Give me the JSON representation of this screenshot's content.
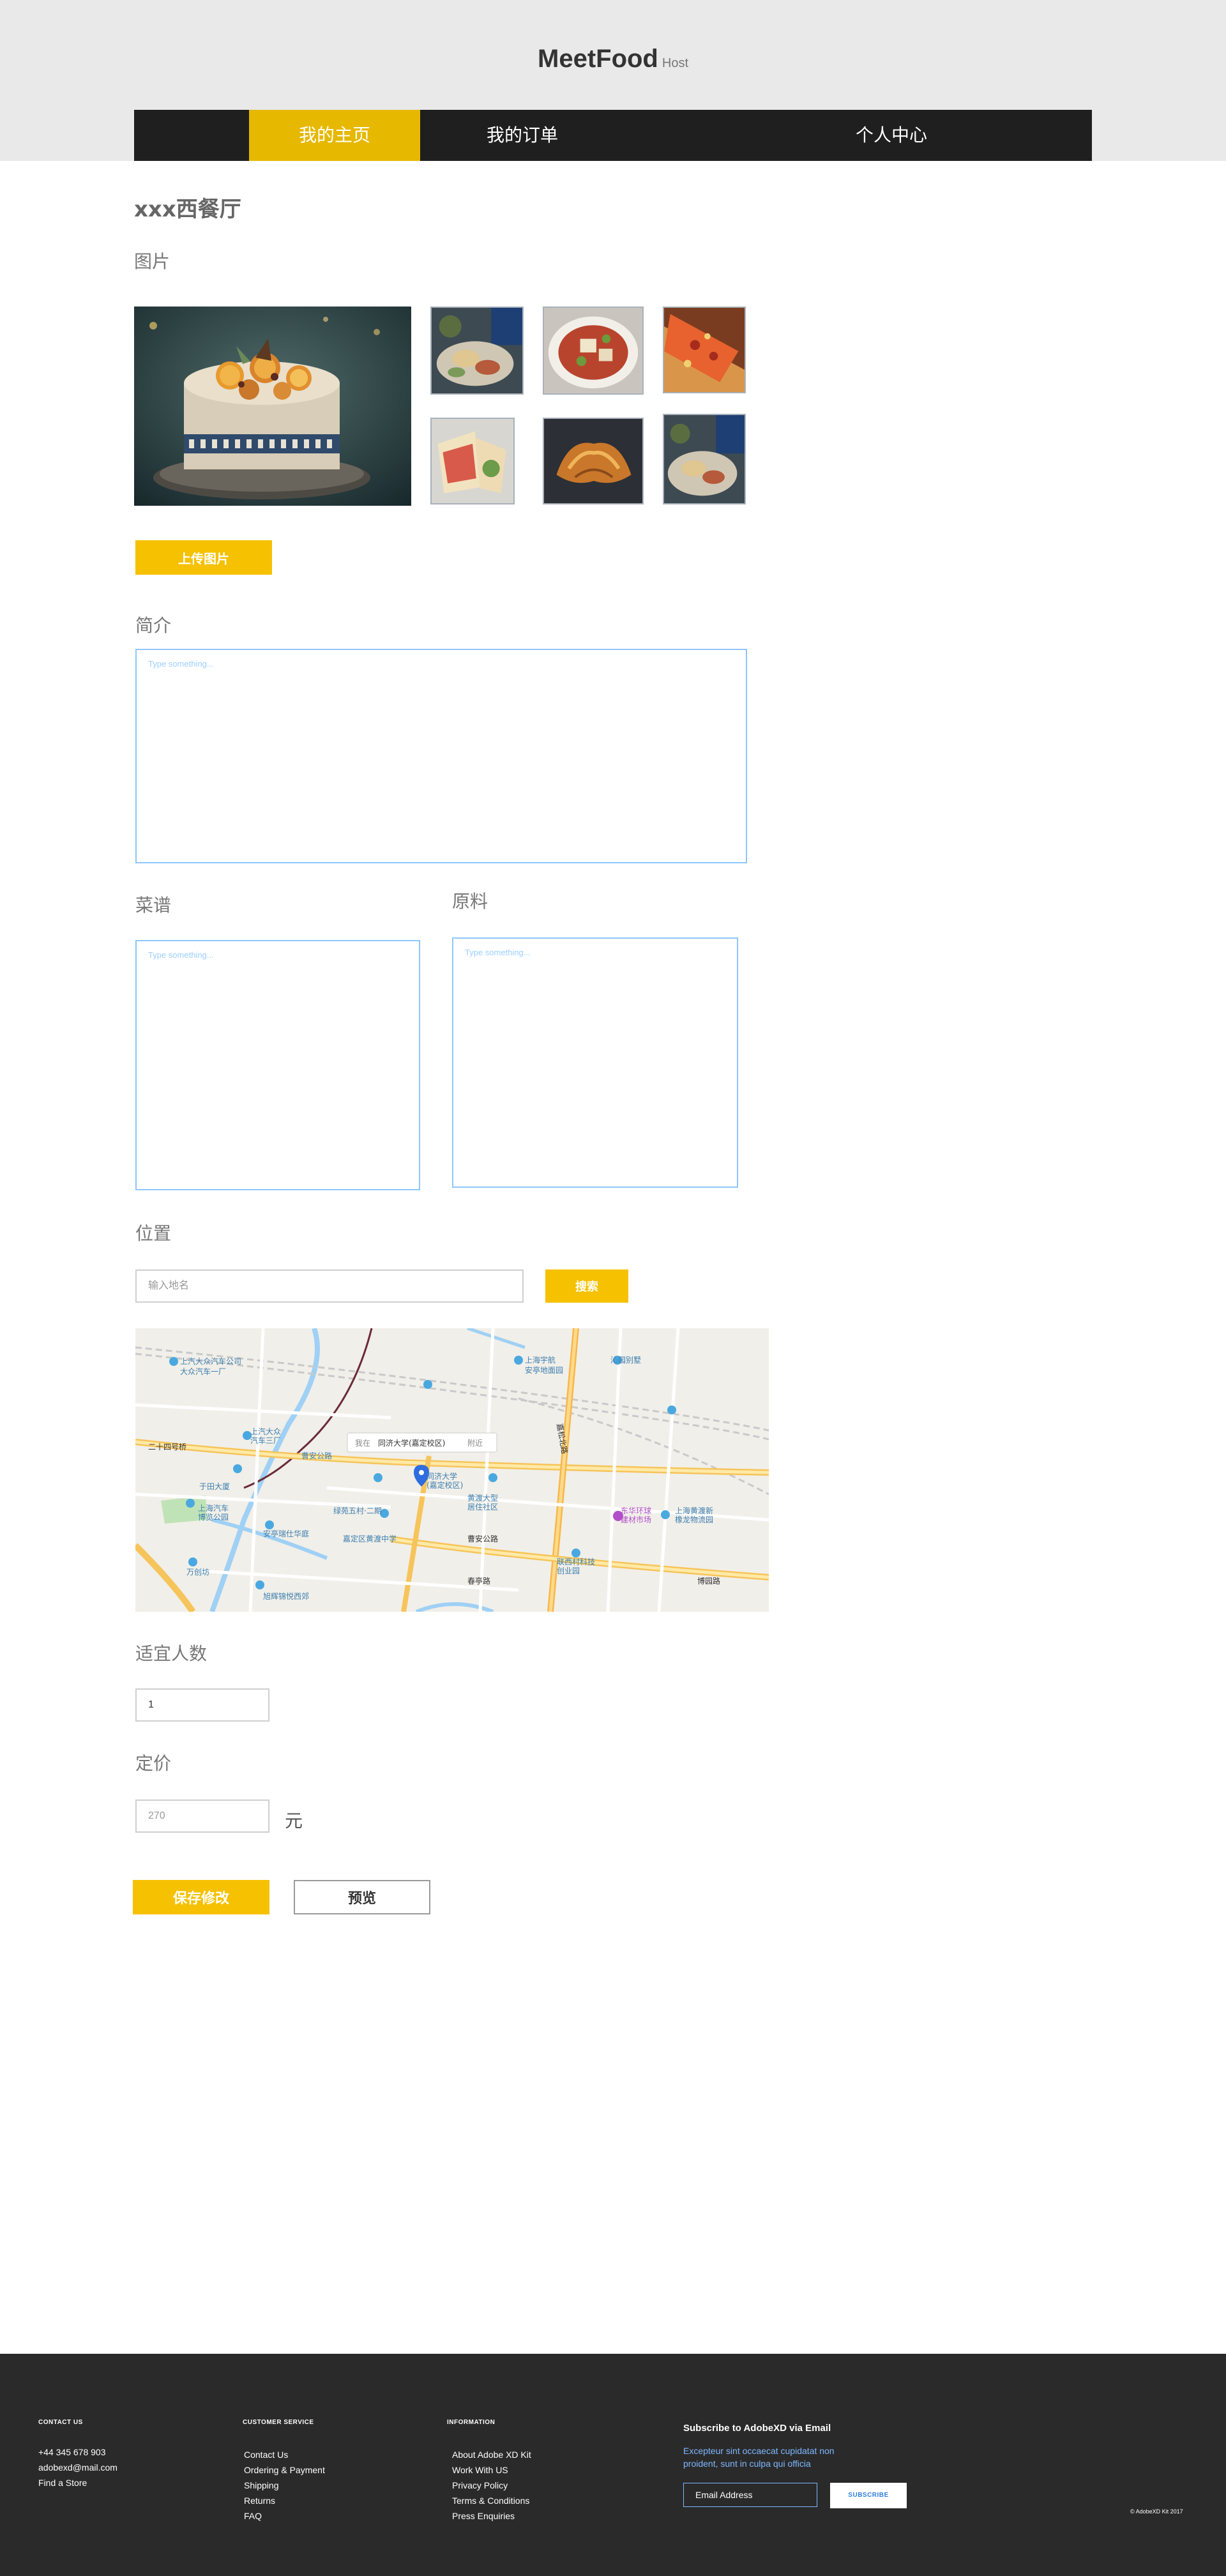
{
  "header": {
    "logo": "MeetFood",
    "logo_sub": "Host"
  },
  "nav": {
    "tabs": [
      {
        "label": "我的主页",
        "active": true
      },
      {
        "label": "我的订单",
        "active": false
      },
      {
        "label": "个人中心",
        "active": false
      }
    ]
  },
  "restaurant": {
    "name": "xxx西餐厅"
  },
  "photos": {
    "label": "图片",
    "upload_button": "上传图片"
  },
  "intro": {
    "label": "简介",
    "placeholder": "Type something..."
  },
  "recipe": {
    "label": "菜谱",
    "placeholder": "Type something..."
  },
  "ingredients": {
    "label": "原料",
    "placeholder": "Type something..."
  },
  "location": {
    "label": "位置",
    "search_placeholder": "输入地名",
    "search_button": "搜索",
    "map": {
      "popup_prefix": "我在",
      "popup_place": "同济大学(嘉定校区)",
      "popup_suffix": "附近",
      "places": [
        "上汽大众汽车公司",
        "大众汽车一厂",
        "上汽大众",
        "汽车三厂",
        "上海宇航",
        "安亭地面园",
        "沁园别墅",
        "曹安公路",
        "同济大学",
        "(嘉定校区)",
        "于田大厦",
        "上海汽车",
        "博览公园",
        "安亭瑞仕华庭",
        "绿苑五村·二期",
        "黄渡大型",
        "居住社区",
        "嘉定区黄渡中学",
        "东华环球",
        "建材市场",
        "上海黄渡新",
        "橡龙物流园",
        "万创坊",
        "旭辉锦悦西郊",
        "联西村科技",
        "创业园",
        "博园路",
        "春亭路",
        "嘉松北路",
        "曹安公路",
        "二十四号桥"
      ]
    }
  },
  "capacity": {
    "label": "适宜人数",
    "value": "1"
  },
  "price": {
    "label": "定价",
    "placeholder": "270",
    "unit": "元"
  },
  "actions": {
    "save_button": "保存修改",
    "preview_button": "预览"
  },
  "footer": {
    "contact": {
      "title": "CONTACT US",
      "items": [
        "+44 345 678 903",
        "adobexd@mail.com",
        "Find a Store"
      ]
    },
    "customer_service": {
      "title": "CUSTOMER SERVICE",
      "items": [
        "Contact Us",
        "Ordering & Payment",
        "Shipping",
        "Returns",
        "FAQ"
      ]
    },
    "information": {
      "title": "INFORMATION",
      "items": [
        "About Adobe XD Kit",
        "Work With US",
        "Privacy Policy",
        "Terms & Conditions",
        "Press Enquiries"
      ]
    },
    "subscribe": {
      "title": "Subscribe to AdobeXD via Email",
      "description_line1": "Excepteur sint occaecat cupidatat non",
      "description_line2": "proident, sunt in culpa qui officia",
      "email_placeholder": "Email Address",
      "button": "SUBSCRIBE"
    },
    "copyright": "© AdobeXD Kit 2017"
  },
  "colors": {
    "accent": "#f5c100",
    "nav_active": "#e6b800",
    "nav_bg": "#1f1f1f",
    "header_bg": "#e9e9e9",
    "footer_bg": "#2a2a2a",
    "input_border": "#8ec6ff",
    "link_blue": "#7fb8ff"
  }
}
